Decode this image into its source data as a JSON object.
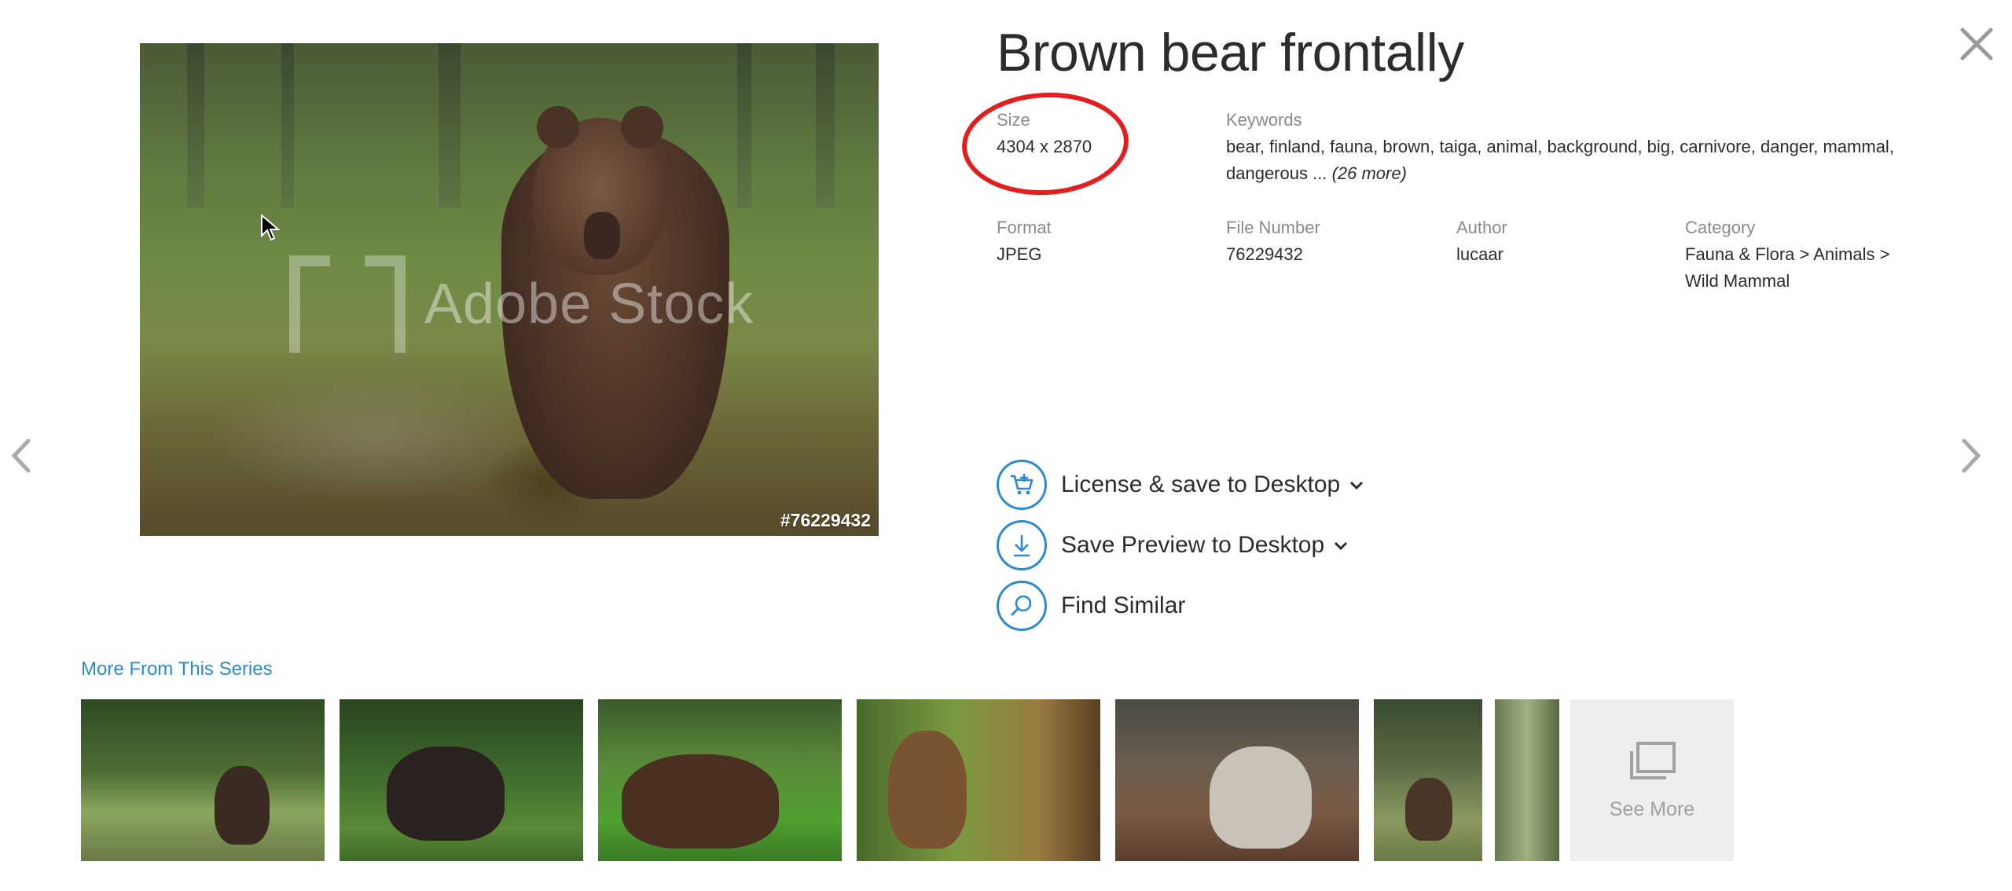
{
  "preview": {
    "watermark": "Adobe Stock",
    "image_id": "#76229432"
  },
  "details": {
    "title": "Brown bear frontally",
    "size_label": "Size",
    "size_value": "4304 x 2870",
    "keywords_label": "Keywords",
    "keywords_line1": "bear, finland, fauna, brown, taiga, animal, background, big, carnivore, danger, mammal,",
    "keywords_line2": "dangerous ...",
    "keywords_more": "(26 more)",
    "format_label": "Format",
    "format_value": "JPEG",
    "file_number_label": "File Number",
    "file_number_value": "76229432",
    "author_label": "Author",
    "author_value": "lucaar",
    "category_label": "Category",
    "category_line1": "Fauna & Flora > Animals >",
    "category_line2": "Wild Mammal"
  },
  "actions": {
    "license": "License & save to Desktop",
    "save_preview": "Save Preview to Desktop",
    "find_similar": "Find Similar"
  },
  "series": {
    "title": "More From This Series",
    "see_more": "See More"
  },
  "colors": {
    "accent": "#2d89d0",
    "annotation": "#e41e1e",
    "text": "#2c2c2c",
    "label": "#8a8a8a"
  },
  "icons": [
    "close-icon",
    "cart-add-icon",
    "download-icon",
    "search-icon",
    "chevron-left-icon",
    "chevron-right-icon",
    "chevron-down-icon",
    "stack-icon",
    "cursor-icon"
  ]
}
